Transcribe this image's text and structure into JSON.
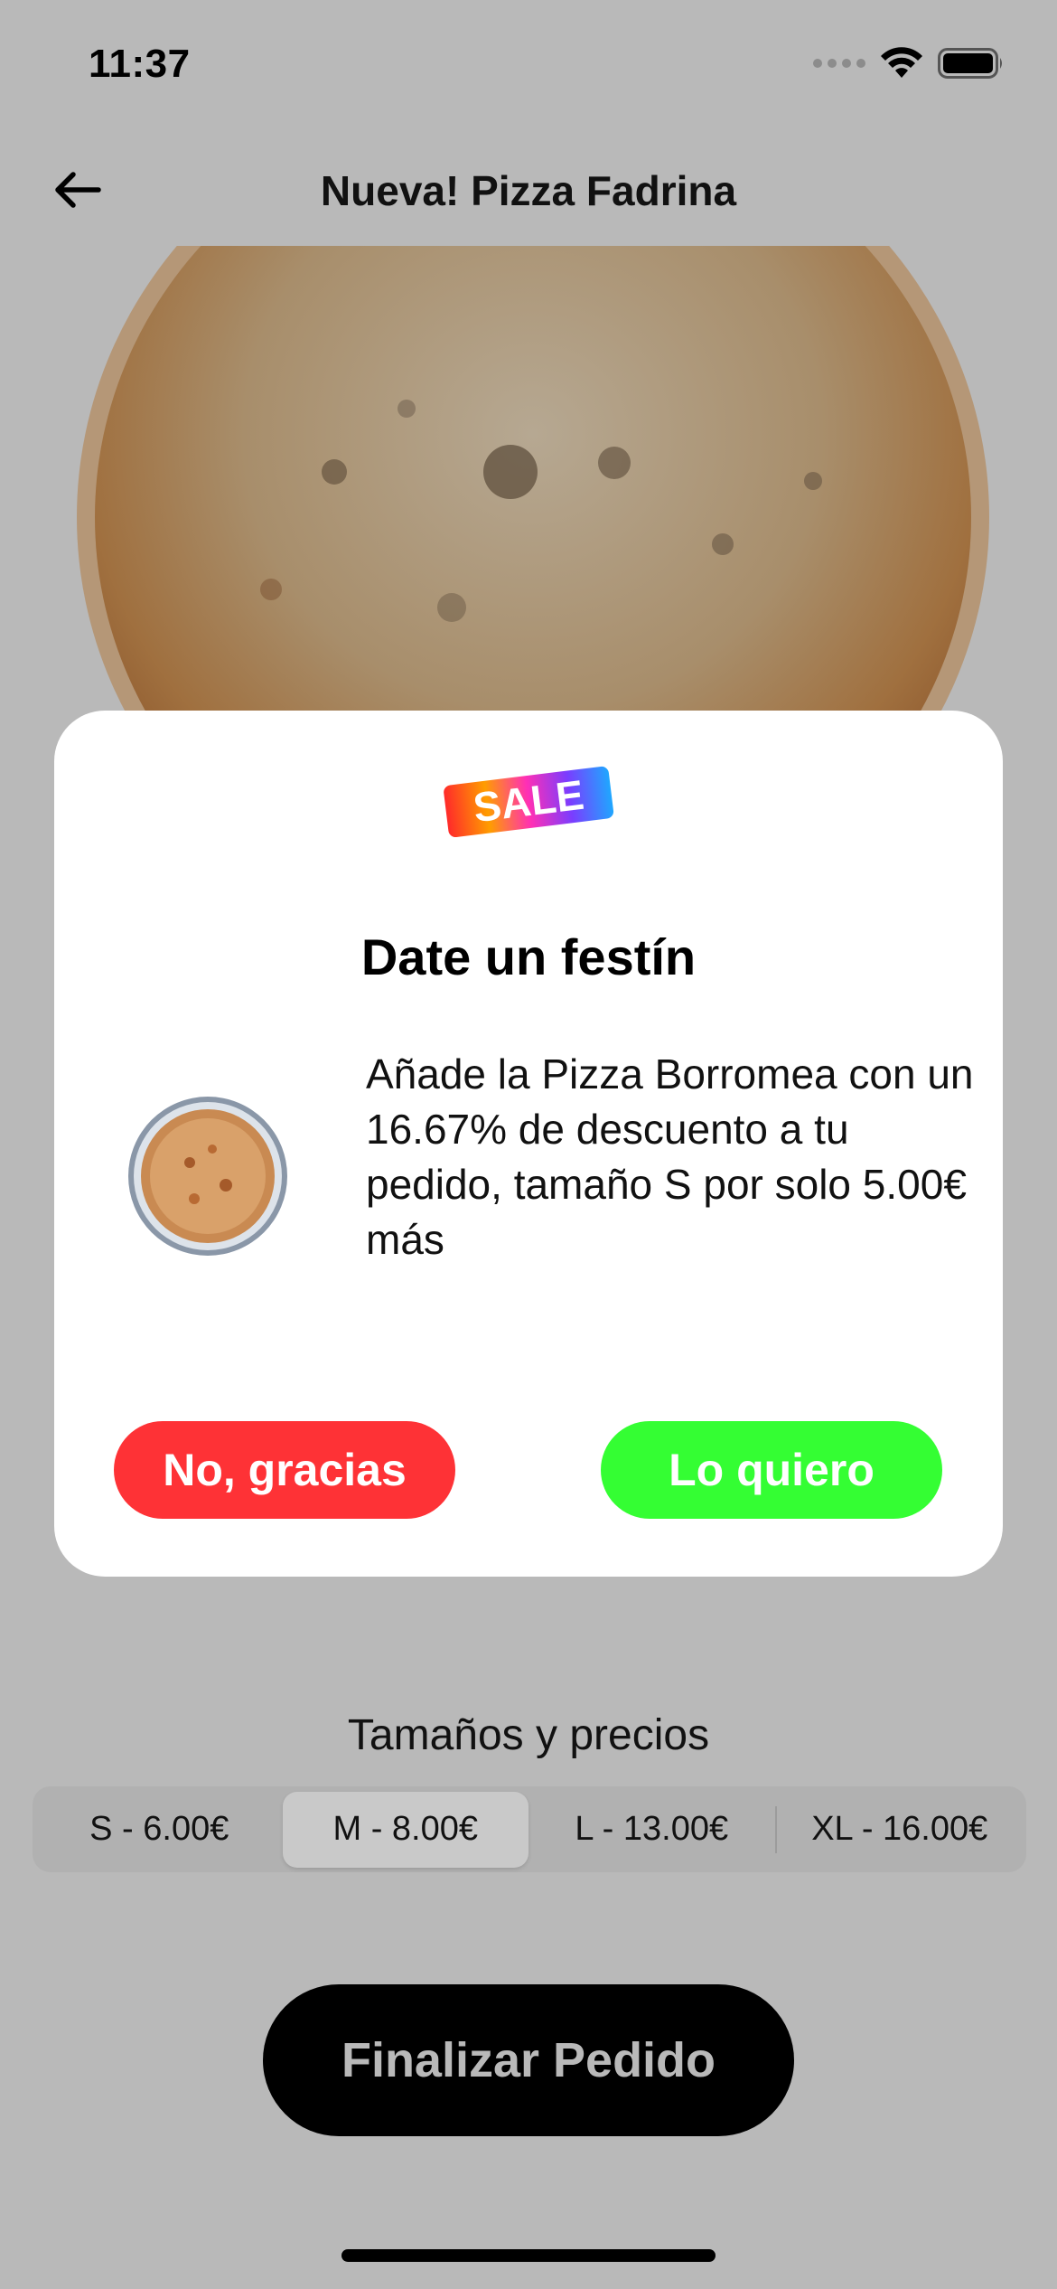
{
  "status_bar": {
    "time": "11:37"
  },
  "nav": {
    "title": "Nueva! Pizza Fadrina",
    "back_icon": "arrow-left-icon"
  },
  "product": {
    "image": "pizza-photo"
  },
  "modal": {
    "badge_text": "SALE",
    "title": "Date un festín",
    "offer_text": "Añade la Pizza Borromea con un 16.67% de descuento a tu pedido, tamaño S por solo 5.00€ más",
    "decline_label": "No, gracias",
    "accept_label": "Lo quiero",
    "colors": {
      "decline": "#fe3236",
      "accept": "#34fe33"
    }
  },
  "sizes": {
    "heading": "Tamaños y precios",
    "options": [
      "S - 6.00€",
      "M - 8.00€",
      "L - 13.00€",
      "XL - 16.00€"
    ],
    "selected": "M - 8.00€"
  },
  "footer": {
    "finish_label": "Finalizar Pedido"
  }
}
